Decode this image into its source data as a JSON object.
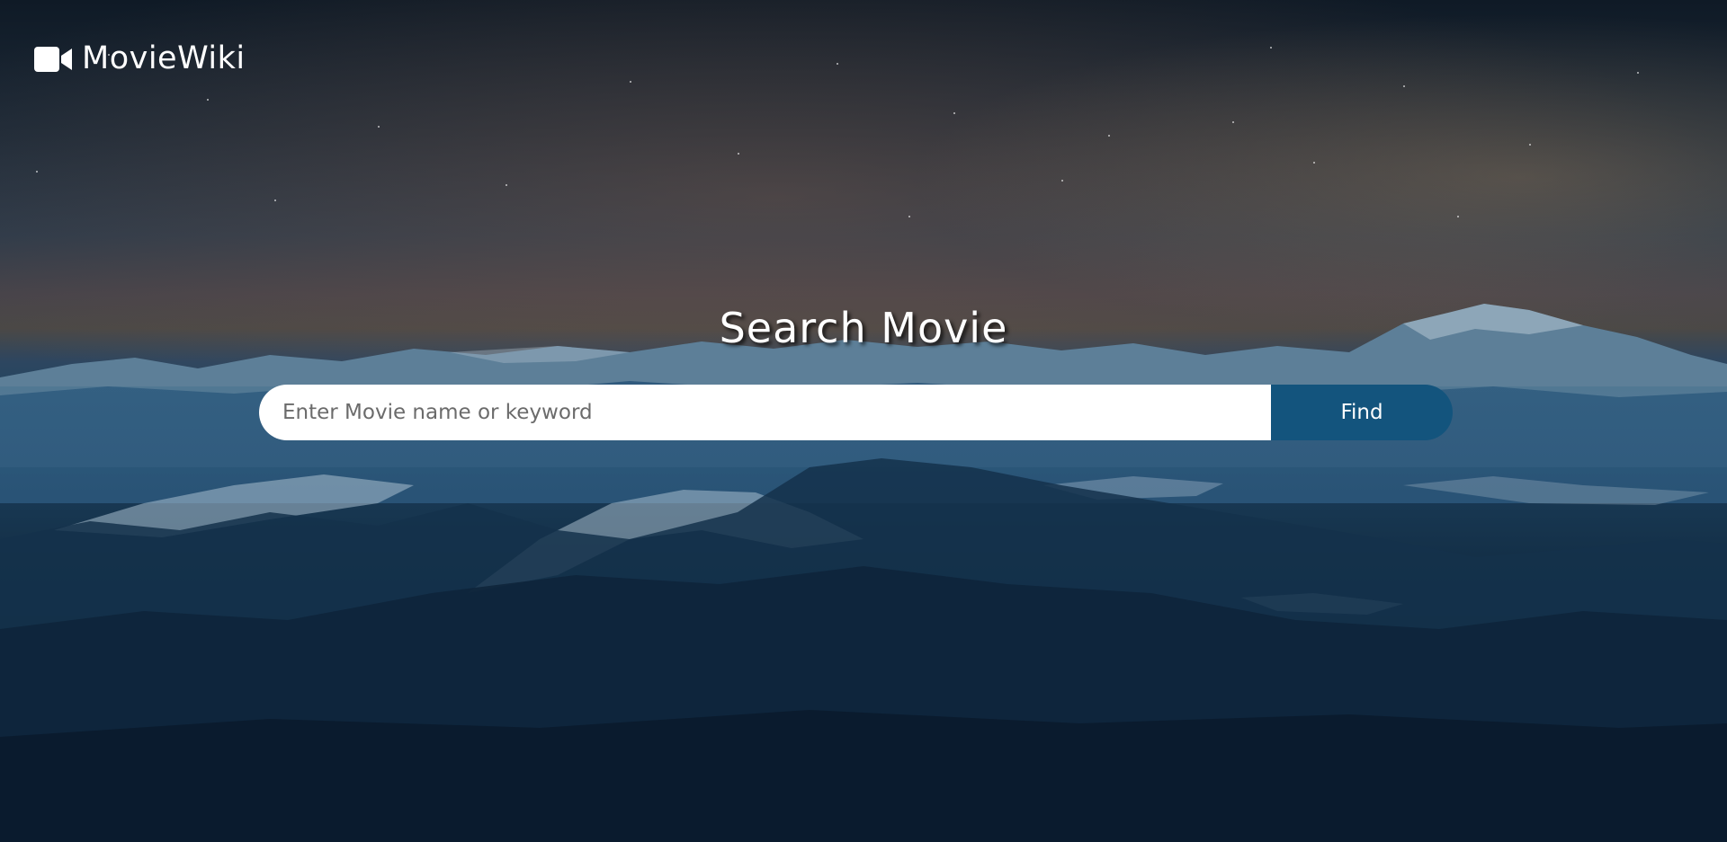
{
  "header": {
    "logo_text": "MovieWiki",
    "logo_icon": "video-camera-icon"
  },
  "main": {
    "title": "Search Movie",
    "search": {
      "placeholder": "Enter Movie name or keyword",
      "value": ""
    },
    "find_button_label": "Find"
  },
  "colors": {
    "accent": "#13547d",
    "text": "#ffffff"
  },
  "background": "night-mountain-landscape"
}
